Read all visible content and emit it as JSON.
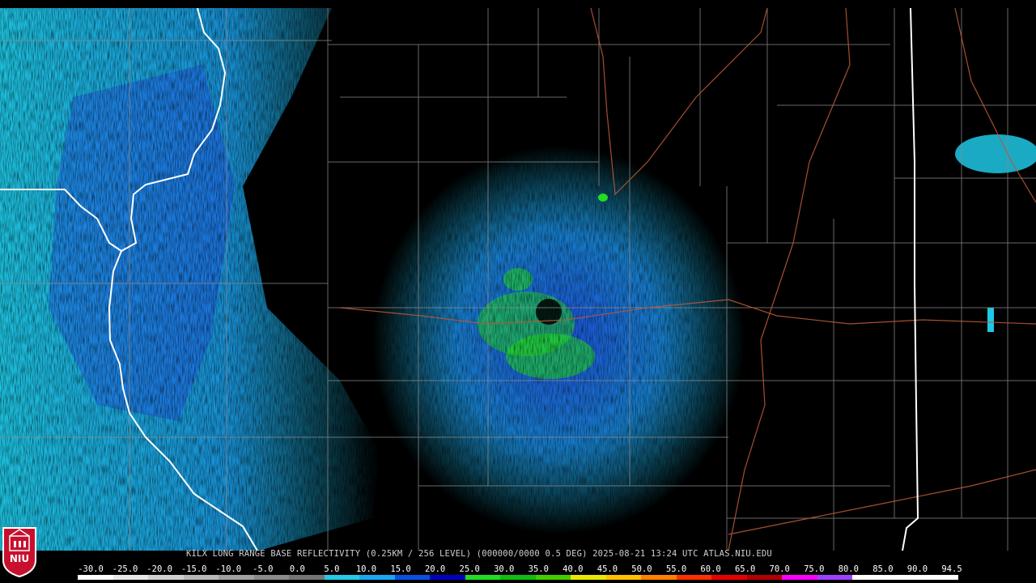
{
  "product": {
    "caption": "KILX LONG RANGE BASE REFLECTIVITY (0.25KM / 256 LEVEL) (000000/0000 0.5 DEG) 2025-08-21 13:24 UTC  ATLAS.NIU.EDU",
    "caption_color": "#cfcfcf",
    "radar_site": "KILX",
    "elevation_deg": 0.5,
    "valid_time_utc": "2025-08-21 13:24"
  },
  "logo": {
    "text": "NIU",
    "color": "#c8102e"
  },
  "colorbar": {
    "label_color": "#ffffff",
    "ticks": [
      "-30.0",
      "-25.0",
      "-20.0",
      "-15.0",
      "-10.0",
      "-5.0",
      "0.0",
      "5.0",
      "10.0",
      "15.0",
      "20.0",
      "25.0",
      "30.0",
      "35.0",
      "40.0",
      "45.0",
      "50.0",
      "55.0",
      "60.0",
      "65.0",
      "70.0",
      "75.0",
      "80.0",
      "85.0",
      "90.0",
      "94.5"
    ],
    "segment_colors": [
      "#ffffff",
      "#e8e8e8",
      "#d0d0d0",
      "#b8b8b8",
      "#a0a0a0",
      "#8a8a8a",
      "#747474",
      "#25c8e6",
      "#1aa6f0",
      "#0a50e0",
      "#0000c0",
      "#22dd22",
      "#11bb11",
      "#44cc00",
      "#e8e800",
      "#ffc000",
      "#ff8000",
      "#ff3000",
      "#e80000",
      "#b00000",
      "#ff00ff",
      "#a040ff",
      "#ffffff",
      "#ffffff",
      "#ffffff"
    ]
  },
  "map_colors": {
    "state_border": "#ffffff",
    "county_line": "#8c8c8c",
    "river_highway": "#b8583a",
    "echo_light": "#1ec8e6",
    "echo_mid": "#1a8fe8",
    "echo_dark": "#1e4fe0",
    "echo_green": "#22dd22"
  }
}
